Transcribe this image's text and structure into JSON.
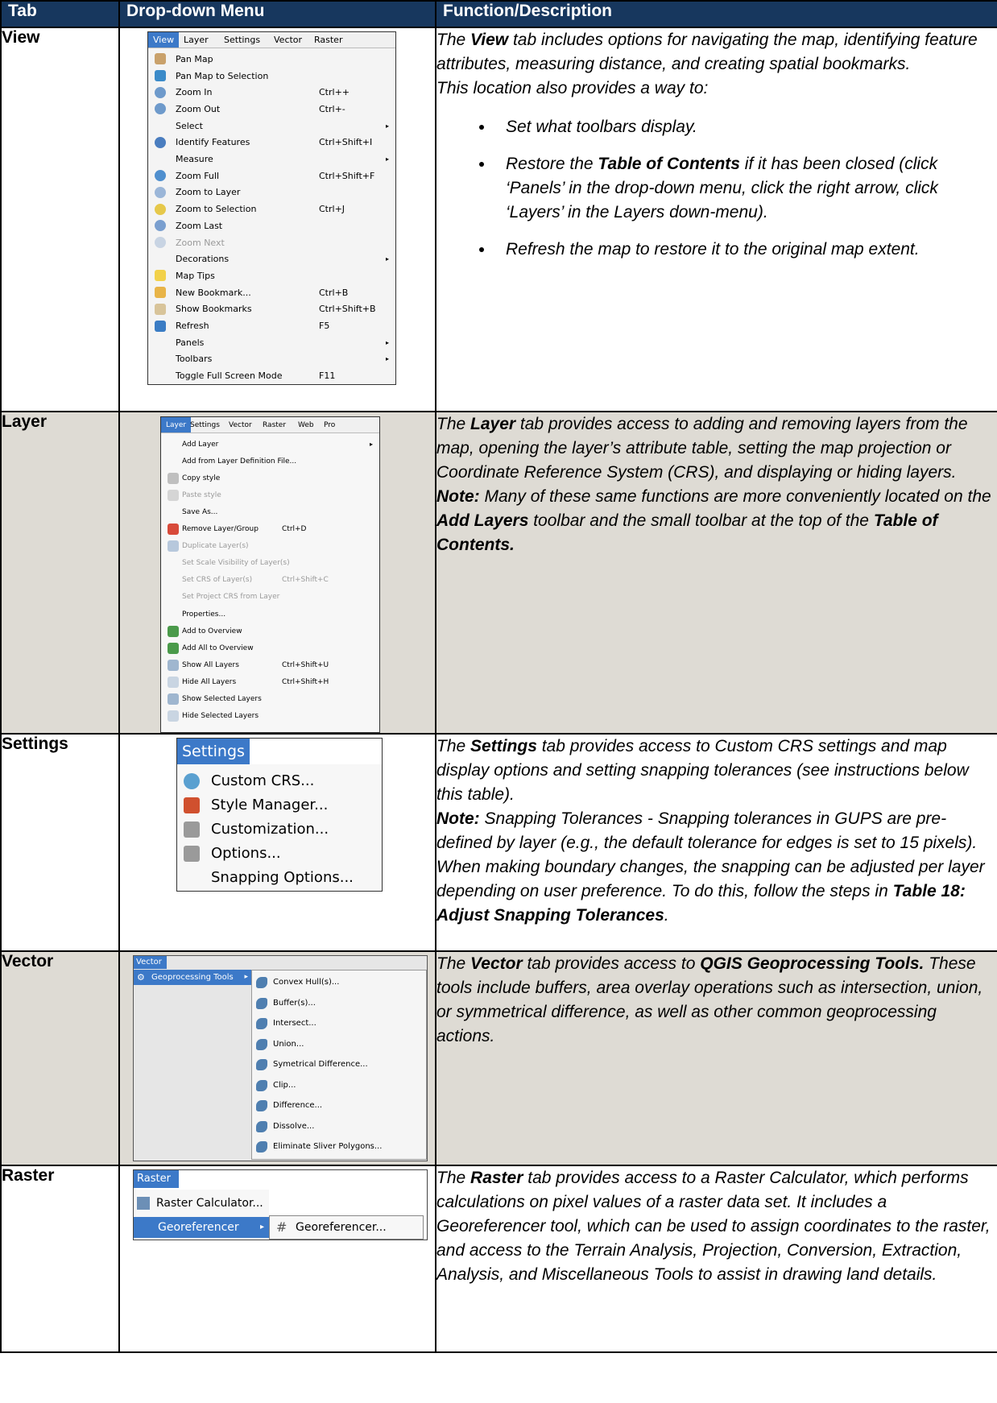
{
  "headers": {
    "tab": "Tab",
    "menu": "Drop-down Menu",
    "desc": "Function/Description"
  },
  "rows": {
    "view": {
      "tab": "View",
      "menubar": [
        "View",
        "Layer",
        "Settings",
        "Vector",
        "Raster"
      ],
      "items": [
        {
          "label": "Pan Map",
          "shortcut": "",
          "icon": "hand-icon"
        },
        {
          "label": "Pan Map to Selection",
          "shortcut": "",
          "icon": "pan-selection-icon"
        },
        {
          "label": "Zoom In",
          "shortcut": "Ctrl++",
          "icon": "zoom-in-icon"
        },
        {
          "label": "Zoom Out",
          "shortcut": "Ctrl+-",
          "icon": "zoom-out-icon"
        },
        {
          "label": "Select",
          "shortcut": "",
          "icon": "",
          "submenu": true
        },
        {
          "label": "Identify Features",
          "shortcut": "Ctrl+Shift+I",
          "icon": "identify-icon"
        },
        {
          "label": "Measure",
          "shortcut": "",
          "icon": "",
          "submenu": true
        },
        {
          "label": "Zoom Full",
          "shortcut": "Ctrl+Shift+F",
          "icon": "zoom-full-icon"
        },
        {
          "label": "Zoom to Layer",
          "shortcut": "",
          "icon": "zoom-layer-icon"
        },
        {
          "label": "Zoom to Selection",
          "shortcut": "Ctrl+J",
          "icon": "zoom-selection-icon"
        },
        {
          "label": "Zoom Last",
          "shortcut": "",
          "icon": "zoom-last-icon"
        },
        {
          "label": "Zoom Next",
          "shortcut": "",
          "icon": "zoom-next-icon",
          "disabled": true
        },
        {
          "label": "Decorations",
          "shortcut": "",
          "icon": "",
          "submenu": true
        },
        {
          "label": "Map Tips",
          "shortcut": "",
          "icon": "map-tips-icon"
        },
        {
          "label": "New Bookmark...",
          "shortcut": "Ctrl+B",
          "icon": "new-bookmark-icon"
        },
        {
          "label": "Show Bookmarks",
          "shortcut": "Ctrl+Shift+B",
          "icon": "show-bookmarks-icon"
        },
        {
          "label": "Refresh",
          "shortcut": "F5",
          "icon": "refresh-icon"
        },
        {
          "label": "Panels",
          "shortcut": "",
          "icon": "",
          "submenu": true
        },
        {
          "label": "Toolbars",
          "shortcut": "",
          "icon": "",
          "submenu": true
        },
        {
          "label": "Toggle Full Screen Mode",
          "shortcut": "F11",
          "icon": ""
        }
      ],
      "desc": {
        "p1_a": "The ",
        "p1_b": "View",
        "p1_c": " tab includes options for navigating the map, identifying feature attributes, measuring distance, and creating spatial bookmarks.",
        "p2": "This location also provides a way to:",
        "b1": "Set what toolbars display.",
        "b2_a": "Restore the ",
        "b2_b": "Table of Contents",
        "b2_c": " if it has been closed (click ‘Panels’ in the drop-down menu, click the right arrow, click ‘Layers’ in the Layers down-menu).",
        "b3": "Refresh the map to restore it to the original map extent."
      }
    },
    "layer": {
      "tab": "Layer",
      "menubar": [
        "Layer",
        "Settings",
        "Vector",
        "Raster",
        "Web",
        "Pro"
      ],
      "items": [
        {
          "label": "Add Layer",
          "shortcut": "",
          "icon": "",
          "submenu": true
        },
        {
          "label": "Add from Layer Definition File...",
          "shortcut": "",
          "icon": ""
        },
        {
          "label": "Copy style",
          "shortcut": "",
          "icon": "copy-style-icon"
        },
        {
          "label": "Paste style",
          "shortcut": "",
          "icon": "paste-style-icon",
          "disabled": true
        },
        {
          "label": "Save As...",
          "shortcut": "",
          "icon": ""
        },
        {
          "label": "Remove Layer/Group",
          "shortcut": "Ctrl+D",
          "icon": "remove-layer-icon"
        },
        {
          "label": "Duplicate Layer(s)",
          "shortcut": "",
          "icon": "duplicate-layer-icon",
          "disabled": true
        },
        {
          "label": "Set Scale Visibility of Layer(s)",
          "shortcut": "",
          "icon": "",
          "disabled": true
        },
        {
          "label": "Set CRS of Layer(s)",
          "shortcut": "Ctrl+Shift+C",
          "icon": "",
          "disabled": true
        },
        {
          "label": "Set Project CRS from Layer",
          "shortcut": "",
          "icon": "",
          "disabled": true
        },
        {
          "label": "Properties...",
          "shortcut": "",
          "icon": ""
        },
        {
          "label": "Add to Overview",
          "shortcut": "",
          "icon": "add-overview-icon"
        },
        {
          "label": "Add All to Overview",
          "shortcut": "",
          "icon": "add-all-overview-icon"
        },
        {
          "label": "Show All Layers",
          "shortcut": "Ctrl+Shift+U",
          "icon": "eye-icon"
        },
        {
          "label": "Hide All Layers",
          "shortcut": "Ctrl+Shift+H",
          "icon": "eye-closed-icon"
        },
        {
          "label": "Show Selected Layers",
          "shortcut": "",
          "icon": "eye-icon"
        },
        {
          "label": "Hide Selected Layers",
          "shortcut": "",
          "icon": "eye-closed-icon"
        }
      ],
      "desc": {
        "p1_a": "The ",
        "p1_b": "Layer",
        "p1_c": " tab provides access to adding and removing layers from the map, opening the layer’s attribute table, setting the map projection or Coordinate Reference System (CRS), and displaying or hiding layers.",
        "n_a": "Note:",
        "n_b": "  Many of these same functions are more conveniently located on the ",
        "n_c": "Add Layers",
        "n_d": " toolbar and the small toolbar at the top of the ",
        "n_e": "Table of Contents."
      }
    },
    "settings": {
      "tab": "Settings",
      "menubar": [
        "Settings"
      ],
      "items": [
        {
          "label": "Custom CRS...",
          "icon": "globe-icon"
        },
        {
          "label": "Style Manager...",
          "icon": "paintbrush-icon"
        },
        {
          "label": "Customization...",
          "icon": "wrench-icon"
        },
        {
          "label": "Options...",
          "icon": "wrench-icon"
        },
        {
          "label": "Snapping Options...",
          "icon": ""
        }
      ],
      "desc": {
        "p1_a": "The ",
        "p1_b": "Settings",
        "p1_c": " tab provides access to Custom CRS settings and map display options and setting snapping tolerances (see instructions below this table).",
        "n_a": "Note:",
        "n_b": "  Snapping Tolerances - Snapping tolerances in GUPS are pre-defined by layer (e.g., the default tolerance for edges is set to 15 pixels). When making boundary changes, the snapping can be adjusted per layer depending on user preference. To do this, follow the steps in ",
        "n_c": "Table 18: Adjust Snapping Tolerances",
        "n_d": "."
      }
    },
    "vector": {
      "tab": "Vector",
      "menubar": [
        "Vector"
      ],
      "parent": "Geoprocessing Tools",
      "items": [
        "Convex Hull(s)...",
        "Buffer(s)...",
        "Intersect...",
        "Union...",
        "Symetrical Difference...",
        "Clip...",
        "Difference...",
        "Dissolve...",
        "Eliminate Sliver Polygons..."
      ],
      "desc": {
        "p1_a": "The ",
        "p1_b": "Vector",
        "p1_c": " tab provides access to ",
        "p1_d": "QGIS Geoprocessing Tools.",
        "p1_e": " These tools include buffers, area overlay operations such as intersection, union, or symmetrical difference, as well as other common geoprocessing actions."
      }
    },
    "raster": {
      "tab": "Raster",
      "menubar": [
        "Raster"
      ],
      "items": [
        "Raster Calculator...",
        "Georeferencer"
      ],
      "sub": "Georeferencer...",
      "desc": {
        "p1_a": "The ",
        "p1_b": "Raster",
        "p1_c": " tab provides access to a Raster Calculator, which performs calculations on pixel values of a raster data set.  It includes a Georeferencer tool, which can be used to assign coordinates to the raster, and access to the Terrain Analysis, Projection, Conversion, Extraction, Analysis, and Miscellaneous Tools to assist in drawing land details."
      }
    }
  }
}
